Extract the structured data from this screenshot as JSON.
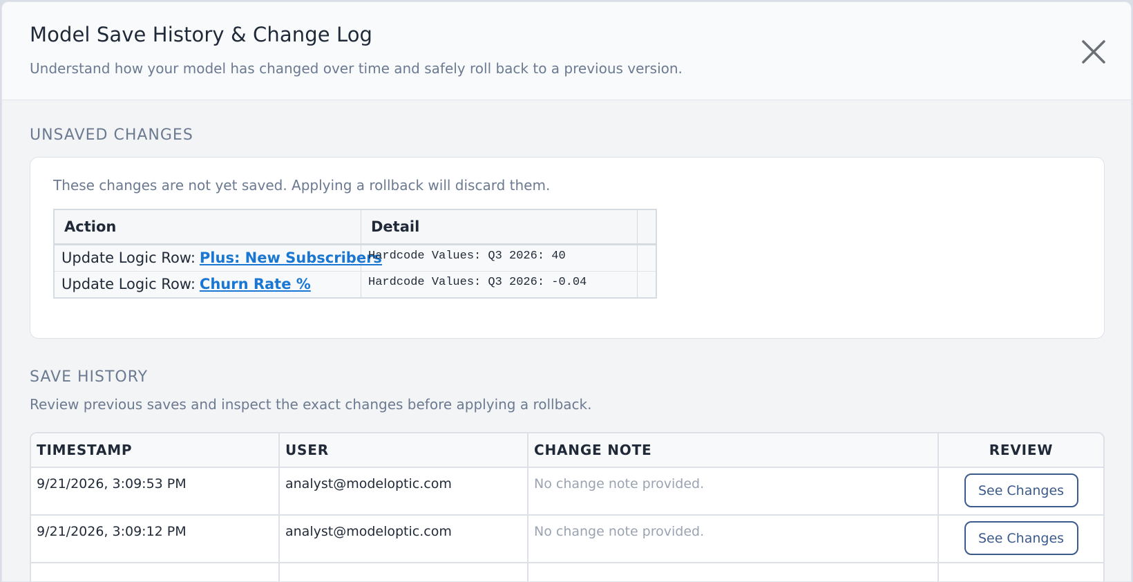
{
  "modal": {
    "title": "Model Save History & Change Log",
    "subtitle": "Understand how your model has changed over time and safely roll back to a previous version.",
    "close_icon": "close-icon"
  },
  "unsaved": {
    "heading": "UNSAVED CHANGES",
    "note": "These changes are not yet saved. Applying a rollback will discard them.",
    "columns": [
      "Action",
      "Detail"
    ],
    "rows": [
      {
        "action_prefix": "Update Logic Row:",
        "row_link": "Plus: New Subscribers",
        "detail": "Hardcode Values: Q3 2026: 40"
      },
      {
        "action_prefix": "Update Logic Row:",
        "row_link": "Churn Rate %",
        "detail": "Hardcode Values: Q3 2026: -0.04"
      }
    ]
  },
  "history": {
    "heading": "SAVE HISTORY",
    "subtitle": "Review previous saves and inspect the exact changes before applying a rollback.",
    "columns": {
      "timestamp": "TIMESTAMP",
      "user": "USER",
      "note": "CHANGE NOTE",
      "review": "REVIEW"
    },
    "rows": [
      {
        "timestamp": "9/21/2026, 3:09:53 PM",
        "user": "analyst@modeloptic.com",
        "note": "No change note provided.",
        "button": "See Changes"
      },
      {
        "timestamp": "9/21/2026, 3:09:12 PM",
        "user": "analyst@modeloptic.com",
        "note": "No change note provided.",
        "button": "See Changes"
      }
    ]
  },
  "colors": {
    "accent": "#3b5a8c",
    "link": "#1976d2",
    "muted_text": "#6b7a90"
  }
}
